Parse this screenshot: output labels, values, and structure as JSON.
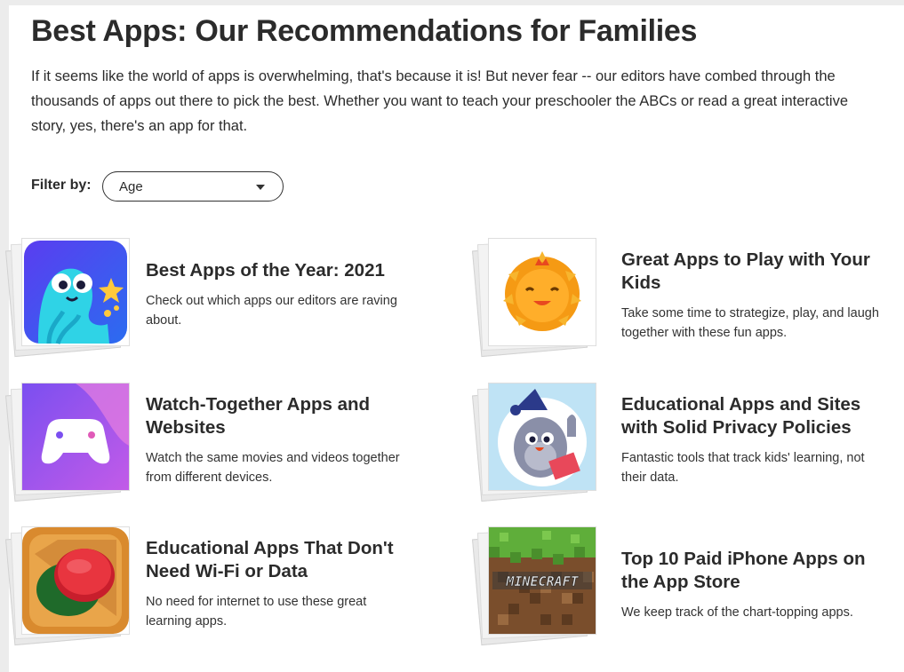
{
  "page": {
    "title": "Best Apps: Our Recommendations for Families",
    "intro": "If it seems like the world of apps is overwhelming, that's because it is! But never fear -- our editors have combed through the thousands of apps out there to pick the best. Whether you want to teach your preschooler the ABCs or read a great interactive story, yes, there's an app for that."
  },
  "filter": {
    "label": "Filter by:",
    "selected": "Age"
  },
  "cards": [
    {
      "title": "Best Apps of the Year: 2021",
      "description": "Check out which apps our editors are raving about.",
      "icon": "blue-octopus-star-icon"
    },
    {
      "title": "Great Apps to Play with Your Kids",
      "description": "Take some time to strategize, play, and laugh together with these fun apps.",
      "icon": "orange-lion-icon"
    },
    {
      "title": "Watch-Together Apps and Websites",
      "description": "Watch the same movies and videos together from different devices.",
      "icon": "game-controller-icon"
    },
    {
      "title": "Educational Apps and Sites with Solid Privacy Policies",
      "description": "Fantastic tools that track kids' learning, not their data.",
      "icon": "reading-seal-icon"
    },
    {
      "title": "Educational Apps That Don't Need Wi-Fi or Data",
      "description": "No need for internet to use these great learning apps.",
      "icon": "red-button-box-icon"
    },
    {
      "title": "Top 10 Paid iPhone Apps on the App Store",
      "description": "We keep track of the chart-topping apps.",
      "icon": "minecraft-icon",
      "icon_text": "MINECRAFT"
    }
  ]
}
